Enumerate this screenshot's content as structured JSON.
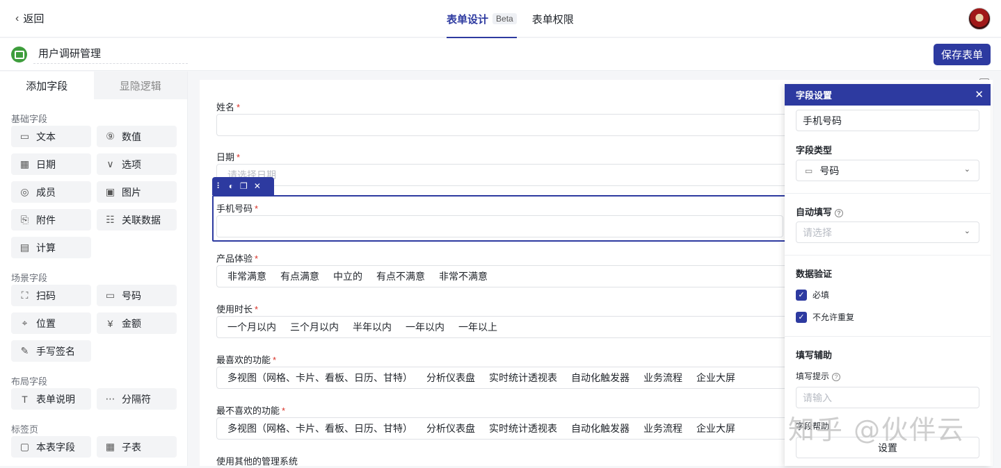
{
  "topbar": {
    "back_label": "返回",
    "tabs": [
      {
        "label": "表单设计",
        "badge": "Beta",
        "active": true
      },
      {
        "label": "表单权限",
        "active": false
      }
    ]
  },
  "formbar": {
    "title": "用户调研管理",
    "save_label": "保存表单"
  },
  "sidebar": {
    "tabs": [
      "添加字段",
      "显隐逻辑"
    ],
    "groups": [
      {
        "title": "基础字段",
        "items": [
          {
            "label": "文本",
            "icon": "text-field-icon"
          },
          {
            "label": "数值",
            "icon": "number-icon"
          },
          {
            "label": "日期",
            "icon": "calendar-icon"
          },
          {
            "label": "选项",
            "icon": "option-icon"
          },
          {
            "label": "成员",
            "icon": "member-icon"
          },
          {
            "label": "图片",
            "icon": "image-icon"
          },
          {
            "label": "附件",
            "icon": "attachment-icon"
          },
          {
            "label": "关联数据",
            "icon": "link-data-icon"
          },
          {
            "label": "计算",
            "icon": "calculator-icon"
          }
        ]
      },
      {
        "title": "场景字段",
        "items": [
          {
            "label": "扫码",
            "icon": "scan-icon"
          },
          {
            "label": "号码",
            "icon": "phone-number-icon"
          },
          {
            "label": "位置",
            "icon": "location-icon"
          },
          {
            "label": "金额",
            "icon": "currency-icon"
          },
          {
            "label": "手写签名",
            "icon": "signature-icon"
          }
        ]
      },
      {
        "title": "布局字段",
        "items": [
          {
            "label": "表单说明",
            "icon": "text-t-icon"
          },
          {
            "label": "分隔符",
            "icon": "separator-icon"
          }
        ]
      },
      {
        "title": "标签页",
        "items": [
          {
            "label": "本表字段",
            "icon": "table-field-icon"
          },
          {
            "label": "子表",
            "icon": "subtable-icon"
          }
        ]
      }
    ]
  },
  "canvas": {
    "questions": [
      {
        "label": "姓名",
        "required": "*",
        "value": ""
      },
      {
        "label": "日期",
        "required": "*",
        "placeholder": "请选择日期"
      },
      {
        "label": "手机号码",
        "required": "*",
        "value": ""
      },
      {
        "label": "产品体验",
        "required": "*",
        "options": [
          "非常满意",
          "有点满意",
          "中立的",
          "有点不满意",
          "非常不满意"
        ]
      },
      {
        "label": "使用时长",
        "required": "*",
        "options": [
          "一个月以内",
          "三个月以内",
          "半年以内",
          "一年以内",
          "一年以上"
        ]
      },
      {
        "label": "最喜欢的功能",
        "required": "*",
        "options": [
          "多视图（网格、卡片、看板、日历、甘特）",
          "分析仪表盘",
          "实时统计透视表",
          "自动化触发器",
          "业务流程",
          "企业大屏"
        ]
      },
      {
        "label": "最不喜欢的功能",
        "required": "*",
        "options": [
          "多视图（网格、卡片、看板、日历、甘特）",
          "分析仪表盘",
          "实时统计透视表",
          "自动化触发器",
          "业务流程",
          "企业大屏"
        ]
      },
      {
        "label": "使用其他的管理系统",
        "required": ""
      }
    ]
  },
  "panel": {
    "title": "字段设置",
    "field_name": "手机号码",
    "type_label": "字段类型",
    "type_value": "号码",
    "autofill_label": "自动填写",
    "autofill_placeholder": "请选择",
    "validation_label": "数据验证",
    "required_label": "必填",
    "unique_label": "不允许重复",
    "assist_label": "填写辅助",
    "hint_label": "填写提示",
    "hint_placeholder": "请输入",
    "help_label": "字段帮助",
    "settings_button": "设置"
  },
  "watermark": "知乎 @伙伴云"
}
